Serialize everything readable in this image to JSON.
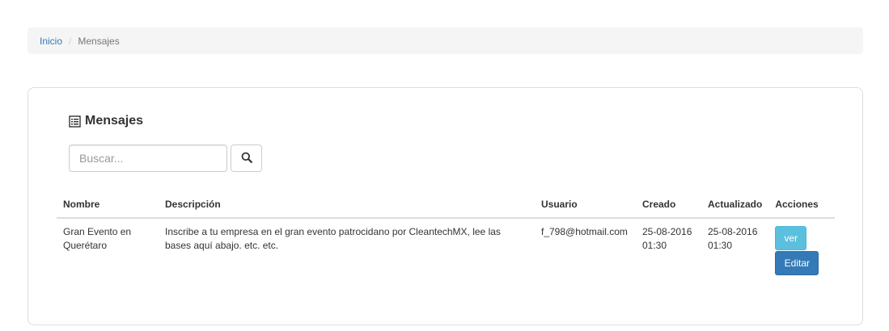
{
  "breadcrumb": {
    "home": "Inicio",
    "separator": "/",
    "current": "Mensajes"
  },
  "panel": {
    "title": "Mensajes",
    "title_icon": "list-alt-icon"
  },
  "search": {
    "placeholder": "Buscar...",
    "value": "",
    "button_icon": "search-icon"
  },
  "table": {
    "headers": {
      "nombre": "Nombre",
      "descripcion": "Descripción",
      "usuario": "Usuario",
      "creado": "Creado",
      "actualizado": "Actualizado",
      "acciones": "Acciones"
    },
    "rows": [
      {
        "nombre": "Gran Evento en Querétaro",
        "descripcion": "Inscribe a tu empresa en el gran evento patrocidano por CleantechMX, lee las bases aquí abajo. etc. etc.",
        "usuario": "f_798@hotmail.com",
        "creado": "25-08-2016 01:30",
        "actualizado": "25-08-2016 01:30",
        "ver_label": "ver",
        "editar_label": "Editar"
      }
    ]
  },
  "colors": {
    "link": "#337ab7",
    "info_button": "#5bc0de",
    "primary_button": "#337ab7",
    "breadcrumb_bg": "#f5f5f5"
  }
}
